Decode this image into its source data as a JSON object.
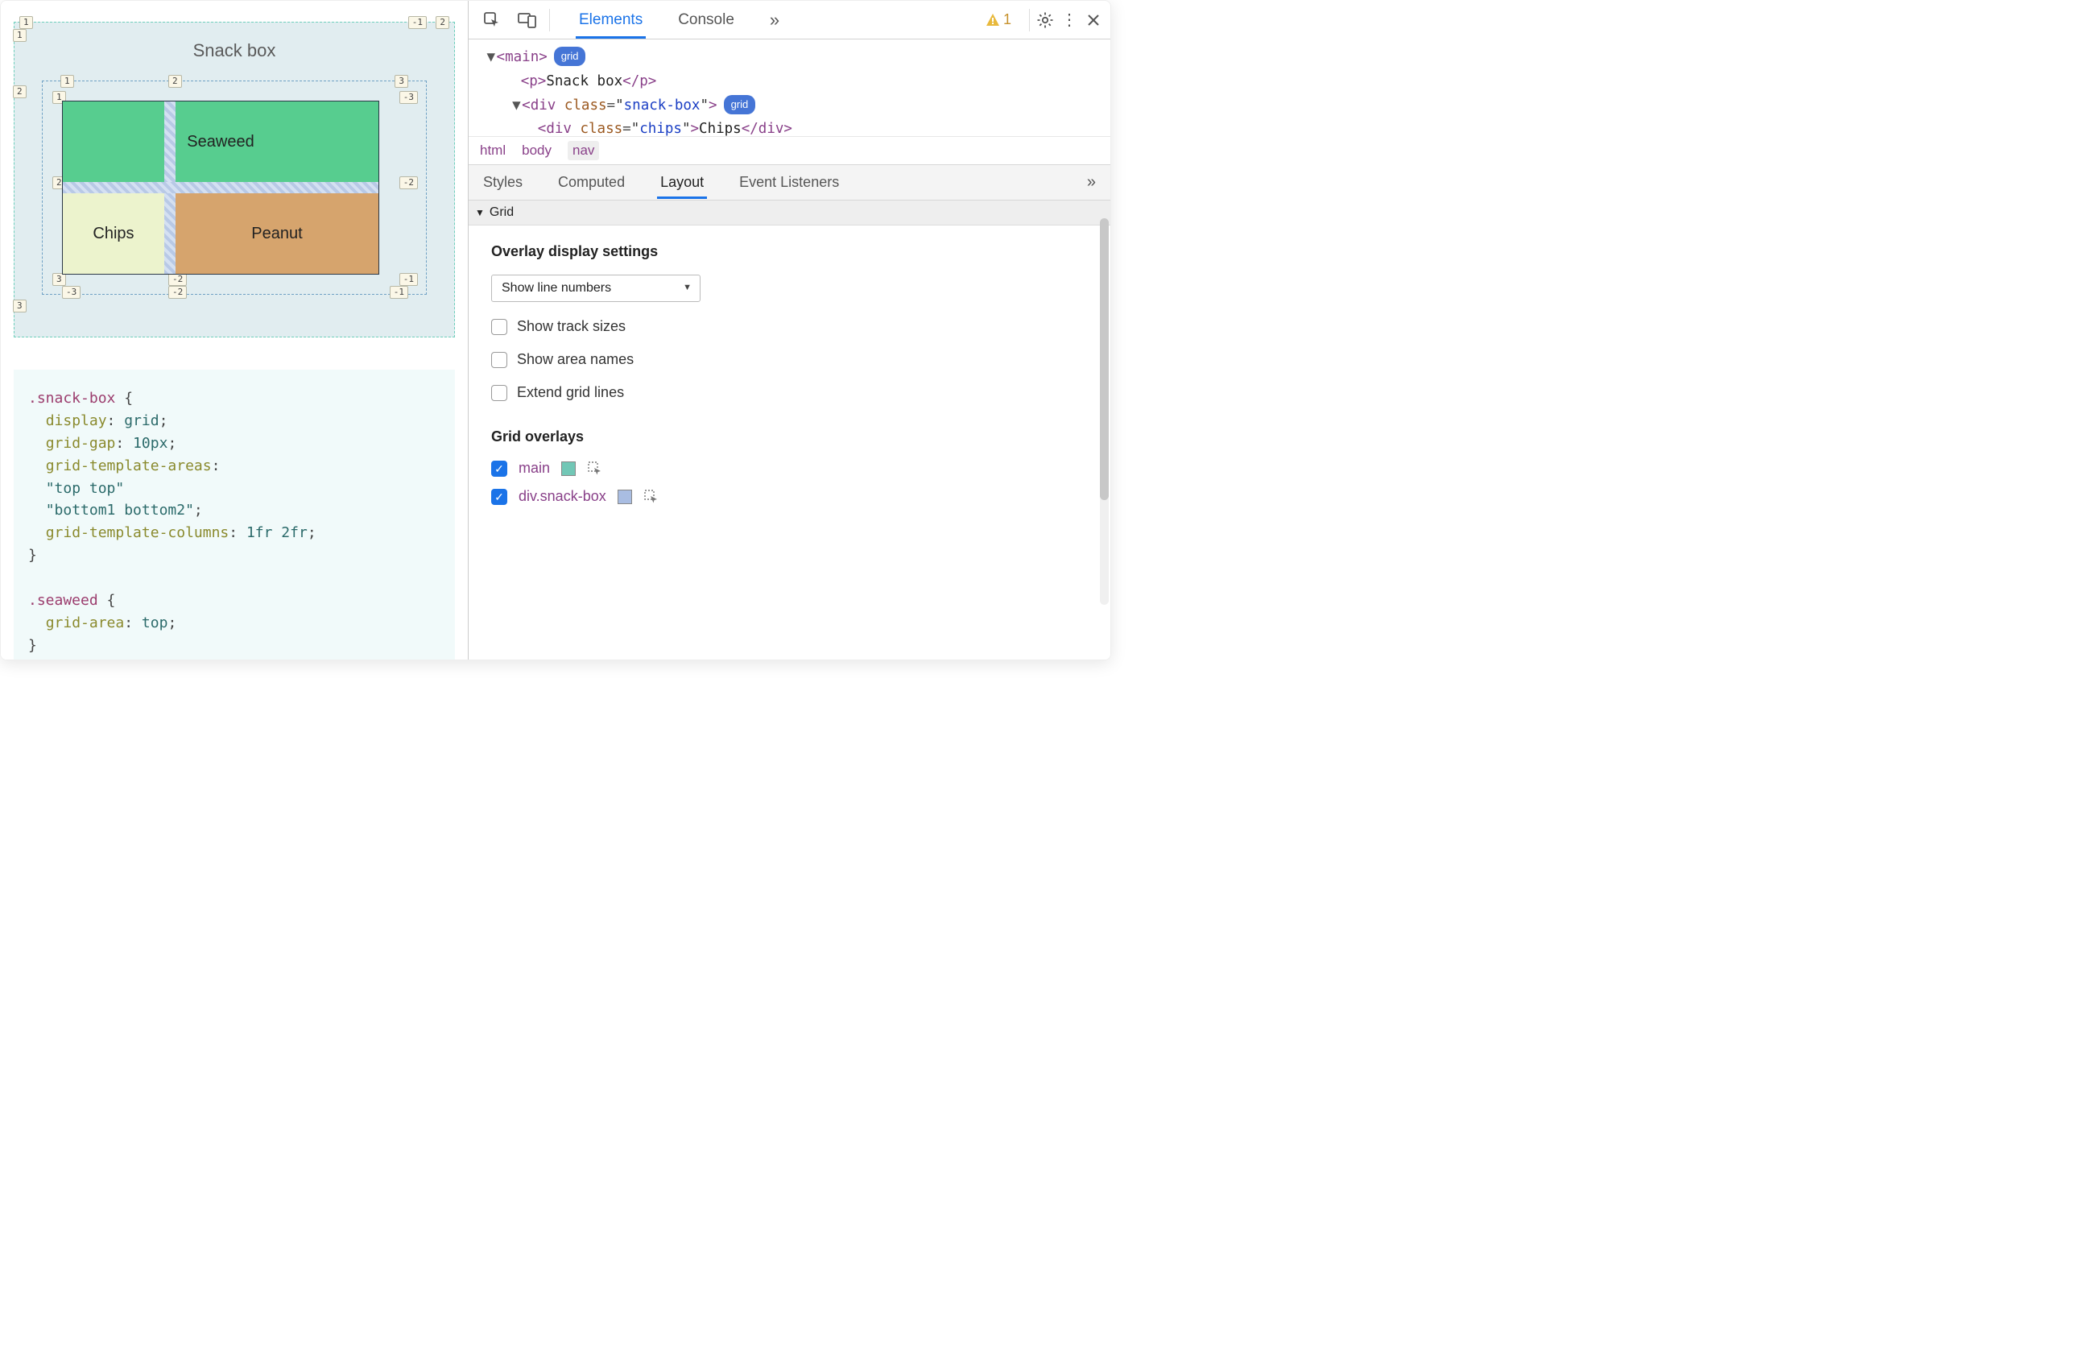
{
  "viewport": {
    "title": "Snack box",
    "cells": {
      "seaweed": "Seaweed",
      "chips": "Chips",
      "peanut": "Peanut"
    },
    "outer_lines": {
      "top": [
        "1",
        "-1",
        "2"
      ],
      "left_row2": "2",
      "left_row3": "3"
    },
    "inner_lines_top": [
      "1",
      "2",
      "3"
    ],
    "inner_lines_top2": [
      "1",
      "-3"
    ],
    "inner_lines_mid_left": "2",
    "inner_lines_mid_right": "-2",
    "inner_lines_bot": [
      "3",
      "-2",
      "-1"
    ],
    "inner_lines_bot2": [
      "-3",
      "-2",
      "-1"
    ],
    "code": ".snack-box {\n  display: grid;\n  grid-gap: 10px;\n  grid-template-areas:\n  \"top top\"\n  \"bottom1 bottom2\";\n  grid-template-columns: 1fr 2fr;\n}\n\n.seaweed {\n  grid-area: top;\n}"
  },
  "devtools": {
    "tabs": [
      "Elements",
      "Console"
    ],
    "active_tab": "Elements",
    "more": "»",
    "warning_count": "1",
    "dom": {
      "l1_tag": "main",
      "l1_badge": "grid",
      "l2_tag": "p",
      "l2_text": "Snack box",
      "l3_tag": "div",
      "l3_attr": "class",
      "l3_val": "snack-box",
      "l3_badge": "grid",
      "l4_tag": "div",
      "l4_attr": "class",
      "l4_val": "chips",
      "l4_text": "Chips"
    },
    "crumbs": [
      "html",
      "body",
      "nav"
    ],
    "subtabs": [
      "Styles",
      "Computed",
      "Layout",
      "Event Listeners"
    ],
    "active_subtab": "Layout",
    "section": "Grid",
    "overlay_settings": {
      "heading": "Overlay display settings",
      "dropdown": "Show line numbers",
      "checks": [
        {
          "label": "Show track sizes",
          "on": false
        },
        {
          "label": "Show area names",
          "on": false
        },
        {
          "label": "Extend grid lines",
          "on": false
        }
      ]
    },
    "grid_overlays": {
      "heading": "Grid overlays",
      "items": [
        {
          "label": "main",
          "on": true,
          "color": "#72c7b6"
        },
        {
          "label": "div.snack-box",
          "on": true,
          "color": "#a9bde2"
        }
      ]
    }
  }
}
